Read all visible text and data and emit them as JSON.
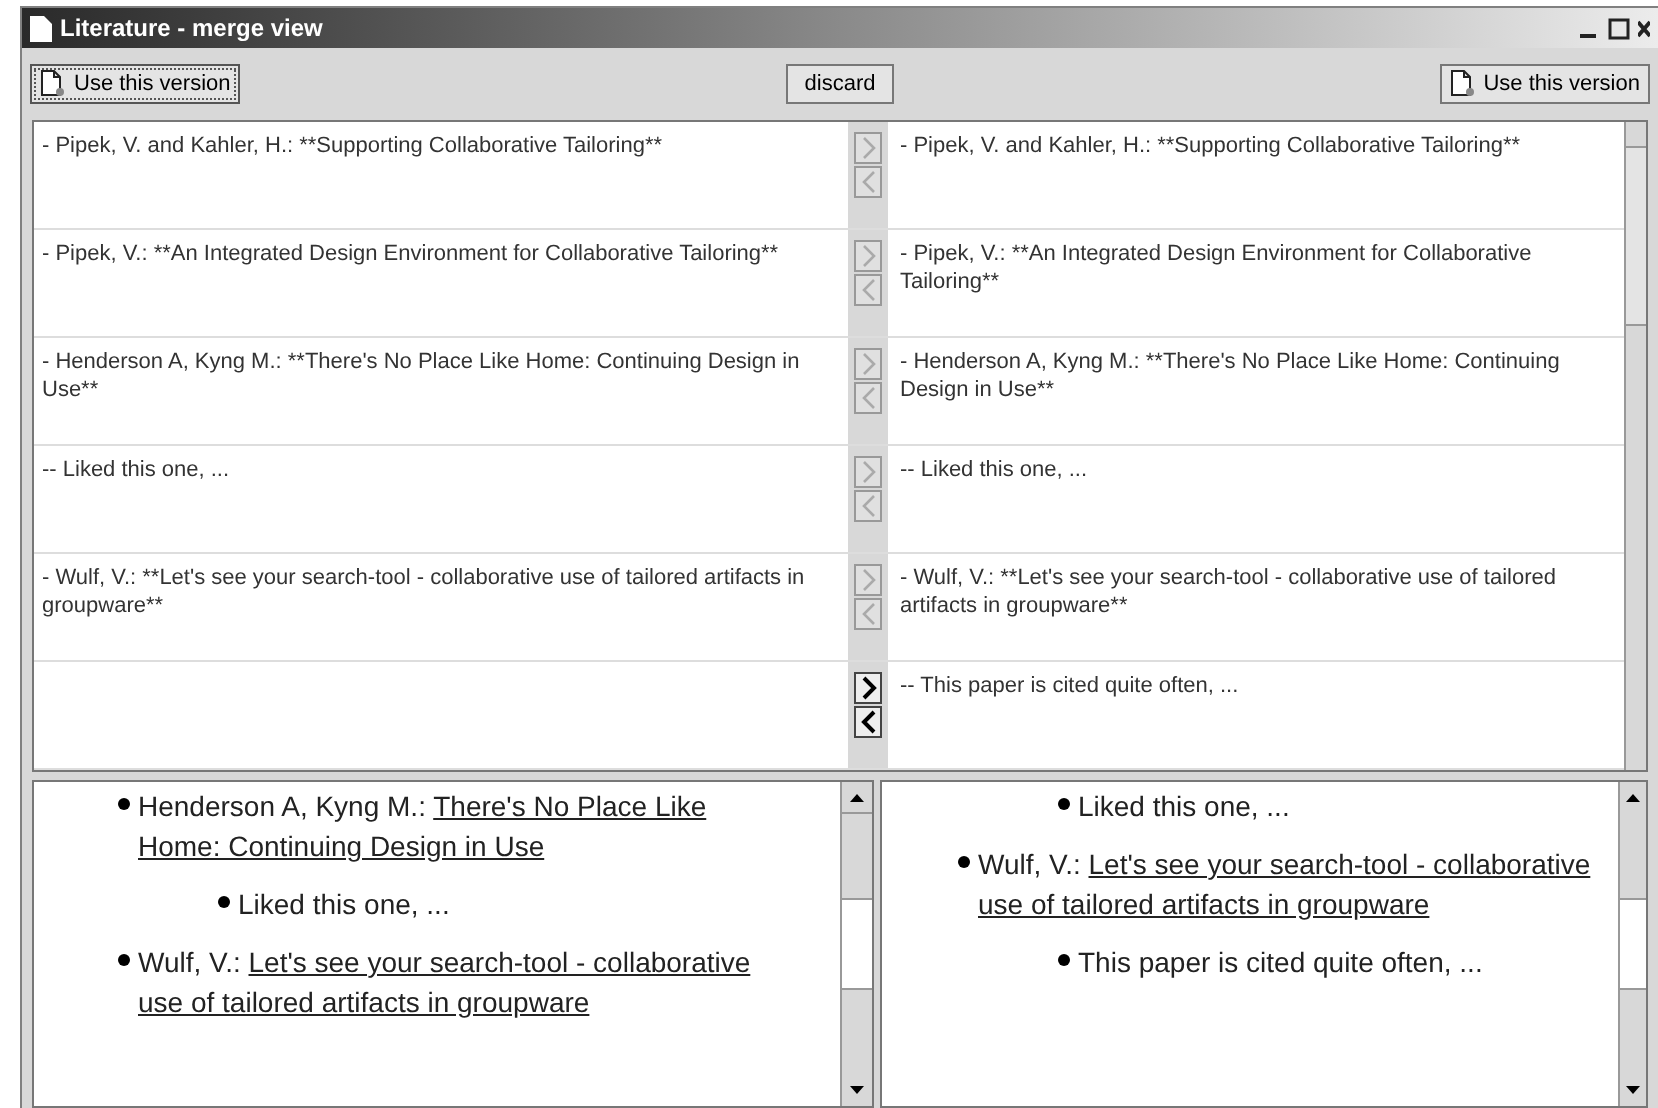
{
  "window": {
    "title": "Literature - merge view"
  },
  "toolbar": {
    "left_button": "Use this version",
    "center_button": "discard",
    "right_button": "Use this version"
  },
  "rows": [
    {
      "left": "- Pipek, V. and Kahler, H.: **Supporting Collaborative Tailoring**",
      "right": "- Pipek, V. and Kahler, H.: **Supporting Collaborative Tailoring**",
      "arrows_enabled": false
    },
    {
      "left": "- Pipek, V.: **An Integrated Design Environment for Collaborative Tailoring**",
      "right": "- Pipek, V.: **An Integrated Design Environment for Collaborative Tailoring**",
      "arrows_enabled": false
    },
    {
      "left": "- Henderson A, Kyng M.: **There's No Place Like Home: Continuing Design in Use**",
      "right": "- Henderson A, Kyng M.: **There's No Place Like Home: Continuing Design in Use**",
      "arrows_enabled": false
    },
    {
      "left": "-- Liked this one, ...",
      "right": "-- Liked this one, ...",
      "arrows_enabled": false
    },
    {
      "left": "- Wulf, V.: **Let's see your search-tool - collaborative use of tailored artifacts in groupware**",
      "right": "- Wulf, V.: **Let's see your search-tool - collaborative use of tailored artifacts in groupware**",
      "arrows_enabled": false
    },
    {
      "right": "-- This paper is cited quite often, ...",
      "arrows_enabled": true
    }
  ],
  "preview_left": [
    {
      "author": "Henderson A, Kyng M.:",
      "title": "There's No Place Like Home: Continuing Design in Use",
      "children": [
        {
          "text": "Liked this one, ..."
        }
      ]
    },
    {
      "author": "Wulf, V.:",
      "title": "Let's see your search-tool - collaborative use of tailored artifacts in groupware"
    }
  ],
  "preview_right": [
    {
      "children": [
        {
          "text": "Liked this one, ..."
        }
      ]
    },
    {
      "author": "Wulf, V.:",
      "title": "Let's see your search-tool - collaborative use of tailored artifacts in groupware",
      "children": [
        {
          "text": "This paper is cited quite often, ..."
        }
      ]
    }
  ]
}
